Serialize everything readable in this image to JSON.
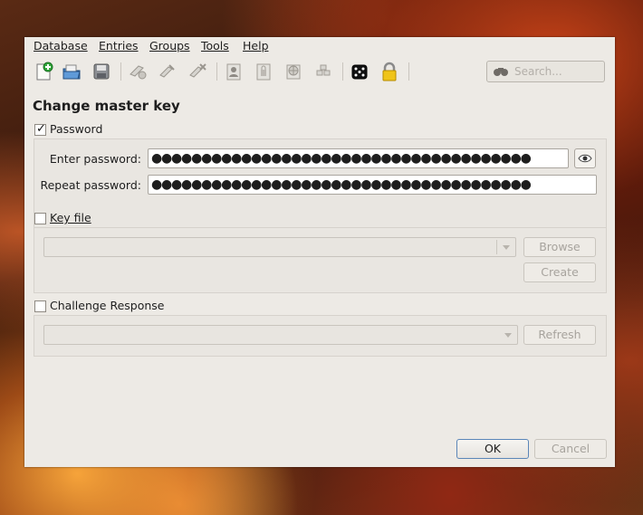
{
  "menu": {
    "database": "Database",
    "entries": "Entries",
    "groups": "Groups",
    "tools": "Tools",
    "help": "Help"
  },
  "toolbar": {
    "icons": [
      "new-database-icon",
      "open-database-icon",
      "save-database-icon",
      "add-entry-icon",
      "edit-entry-icon",
      "delete-entry-icon",
      "copy-username-icon",
      "copy-password-icon",
      "open-url-icon",
      "auto-type-icon",
      "password-generator-icon",
      "lock-database-icon"
    ],
    "search_placeholder": "Search..."
  },
  "dialog": {
    "title": "Change master key",
    "password": {
      "label": "Password",
      "checked": true,
      "enter_label": "Enter password:",
      "enter_value": "●●●●●●●●●●●●●●●●●●●●●●●●●●●●●●●●●●●●●●",
      "repeat_label": "Repeat password:",
      "repeat_value": "●●●●●●●●●●●●●●●●●●●●●●●●●●●●●●●●●●●●●●"
    },
    "key_file": {
      "label": "Key file",
      "checked": false,
      "browse": "Browse",
      "create": "Create"
    },
    "challenge": {
      "label": "Challenge Response",
      "checked": false,
      "refresh": "Refresh"
    },
    "ok": "OK",
    "cancel": "Cancel"
  },
  "colors": {
    "window_bg": "#edeae5",
    "accent_border": "#5b86b8"
  }
}
